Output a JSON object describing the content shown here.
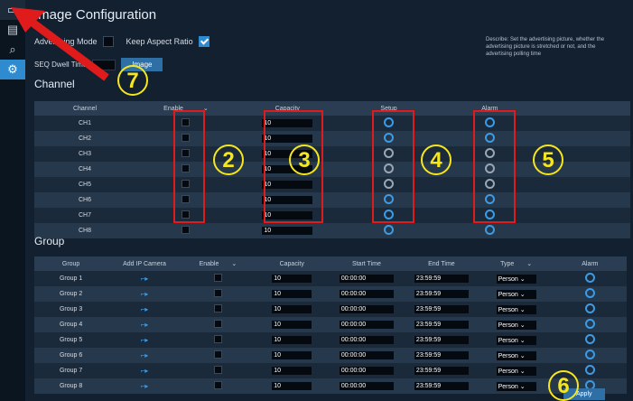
{
  "sidebar": {
    "icons": [
      "monitor-icon",
      "record-icon",
      "search-icon",
      "settings-icon"
    ]
  },
  "page_title": "Image Configuration",
  "settings": {
    "advertising_mode_label": "Advertising Mode",
    "keep_aspect_label": "Keep Aspect Ratio",
    "seq_dwell_label": "SEQ Dwell Time",
    "image_button": "Image",
    "description": "Describe: Set the advertising picture, whether the advertising picture is stretched or not, and the advertising polling time"
  },
  "channel": {
    "section_title": "Channel",
    "headers": [
      "Channel",
      "Enable",
      "Capacity",
      "Setup",
      "Alarm"
    ],
    "rows": [
      {
        "name": "CH1",
        "capacity": "10"
      },
      {
        "name": "CH2",
        "capacity": "10"
      },
      {
        "name": "CH3",
        "capacity": "10"
      },
      {
        "name": "CH4",
        "capacity": "10"
      },
      {
        "name": "CH5",
        "capacity": "10"
      },
      {
        "name": "CH6",
        "capacity": "10"
      },
      {
        "name": "CH7",
        "capacity": "10"
      },
      {
        "name": "CH8",
        "capacity": "10"
      }
    ]
  },
  "group": {
    "section_title": "Group",
    "headers": [
      "Group",
      "Add IP Camera",
      "Enable",
      "Capacity",
      "Start Time",
      "End Time",
      "Type",
      "Alarm"
    ],
    "rows": [
      {
        "name": "Group 1",
        "capacity": "10",
        "start": "00:00:00",
        "end": "23:59:59",
        "type": "Person"
      },
      {
        "name": "Group 2",
        "capacity": "10",
        "start": "00:00:00",
        "end": "23:59:59",
        "type": "Person"
      },
      {
        "name": "Group 3",
        "capacity": "10",
        "start": "00:00:00",
        "end": "23:59:59",
        "type": "Person"
      },
      {
        "name": "Group 4",
        "capacity": "10",
        "start": "00:00:00",
        "end": "23:59:59",
        "type": "Person"
      },
      {
        "name": "Group 5",
        "capacity": "10",
        "start": "00:00:00",
        "end": "23:59:59",
        "type": "Person"
      },
      {
        "name": "Group 6",
        "capacity": "10",
        "start": "00:00:00",
        "end": "23:59:59",
        "type": "Person"
      },
      {
        "name": "Group 7",
        "capacity": "10",
        "start": "00:00:00",
        "end": "23:59:59",
        "type": "Person"
      },
      {
        "name": "Group 8",
        "capacity": "10",
        "start": "00:00:00",
        "end": "23:59:59",
        "type": "Person"
      }
    ]
  },
  "apply_button": "Apply",
  "annotations": [
    "2",
    "3",
    "4",
    "5",
    "6",
    "7"
  ],
  "colors": {
    "highlight": "#e01b1b",
    "callout": "#f6e71c",
    "accent": "#2e8bd0"
  }
}
